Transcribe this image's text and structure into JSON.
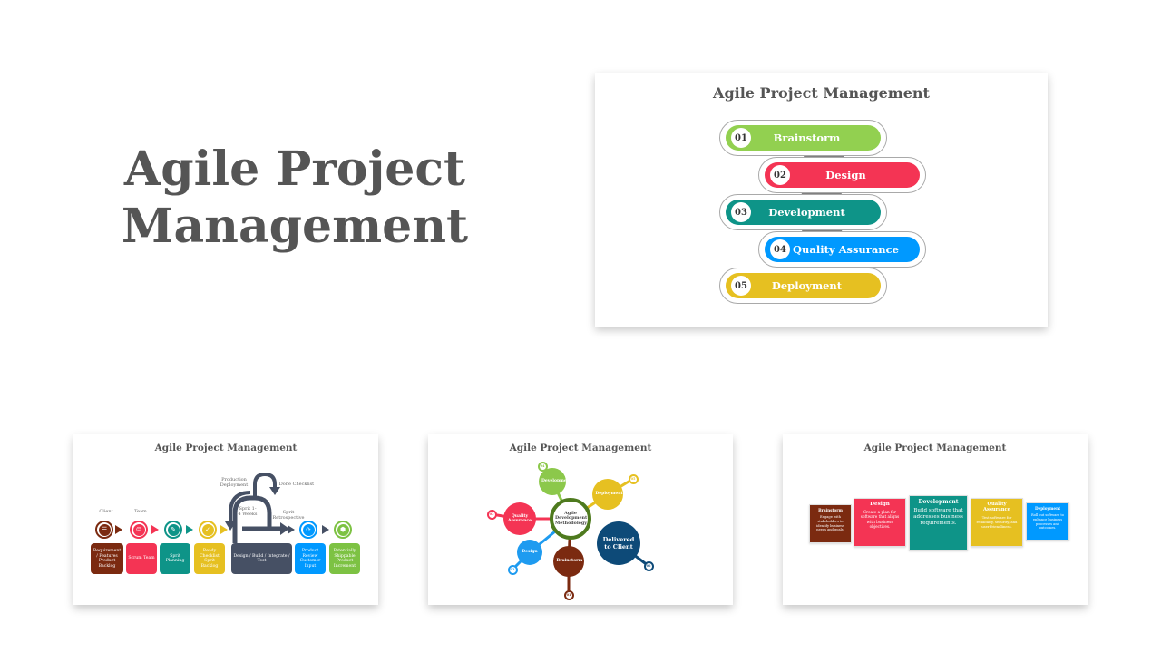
{
  "hero": {
    "line1": "Agile Project",
    "line2": "Management"
  },
  "main_slide": {
    "title": "Agile Project Management",
    "steps": [
      {
        "num": "01",
        "label": "Brainstorm",
        "color": "#92d050"
      },
      {
        "num": "02",
        "label": "Design",
        "color": "#f43454"
      },
      {
        "num": "03",
        "label": "Development",
        "color": "#0e9488"
      },
      {
        "num": "04",
        "label": "Quality Assurance",
        "color": "#0099ff"
      },
      {
        "num": "05",
        "label": "Deployment",
        "color": "#e6c021"
      }
    ]
  },
  "thumb1": {
    "title": "Agile Project Management",
    "top_labels": {
      "client": "Client",
      "team": "Team"
    },
    "loop_labels": {
      "production": "Production Deployment",
      "done": "Done Checklist",
      "sprint": "Sprit 1-4 Weeks",
      "retro": "Sprit Retrospective"
    },
    "boxes": [
      {
        "label": "Requirement / Features Product Backlog",
        "color": "#7b2a10",
        "icon": "clipboard-icon"
      },
      {
        "label": "Scrum Team",
        "color": "#f43454",
        "icon": "team-icon"
      },
      {
        "label": "Sprit Planning",
        "color": "#0e9488",
        "icon": "planning-icon"
      },
      {
        "label": "Ready Checklist Sprit Backlog",
        "color": "#e6c021",
        "icon": "checklist-icon"
      },
      {
        "label": "Design / Build / Integrate / Test",
        "color": "#465064",
        "icon": ""
      },
      {
        "label": "Product Review Customer Input",
        "color": "#0099ff",
        "icon": "review-icon"
      },
      {
        "label": "Potentially Shippable Product Increment",
        "color": "#7dc243",
        "icon": "product-icon"
      }
    ]
  },
  "thumb2": {
    "title": "Agile Project Management",
    "center": "Agile Development Methodology",
    "nodes": [
      {
        "num": "01",
        "label": "Brainstorm",
        "color": "#7b2a10"
      },
      {
        "num": "02",
        "label": "Design",
        "color": "#1e9bf0"
      },
      {
        "num": "03",
        "label": "Quality Assurance",
        "color": "#f43454"
      },
      {
        "num": "04",
        "label": "Development",
        "color": "#8cc84b"
      },
      {
        "num": "05",
        "label": "Deployment",
        "color": "#e6c021"
      },
      {
        "num": "06",
        "label": "Delivered to Client",
        "color": "#0d4a78"
      }
    ]
  },
  "thumb3": {
    "title": "Agile Project Management",
    "cards": [
      {
        "title": "Brainstorm",
        "desc": "Engage with stakeholders to identify business needs and goals.",
        "color": "#7b2a10"
      },
      {
        "title": "Design",
        "desc": "Create a plan for software that aligns with business objectives.",
        "color": "#f43454"
      },
      {
        "title": "Development",
        "desc": "Build software that addresses business requirements.",
        "color": "#0e9488"
      },
      {
        "title": "Quality Assurance",
        "desc": "Test software for reliability, security, and user-friendliness.",
        "color": "#e6c021"
      },
      {
        "title": "Deployment",
        "desc": "Roll out software to enhance business processes and outcomes.",
        "color": "#0099ff"
      }
    ]
  }
}
